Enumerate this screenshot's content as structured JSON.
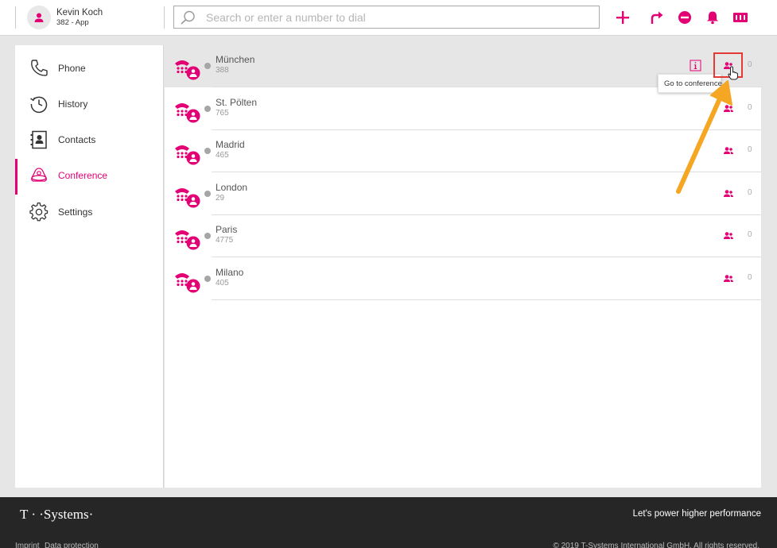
{
  "user": {
    "name": "Kevin Koch",
    "line": "382 - App"
  },
  "search": {
    "placeholder": "Search or enter a number to dial"
  },
  "header_actions": [
    "add-icon",
    "forward-icon",
    "dnd-icon",
    "bell-icon",
    "panel-icon"
  ],
  "nav": [
    {
      "id": "phone",
      "label": "Phone",
      "icon": "phone-icon"
    },
    {
      "id": "history",
      "label": "History",
      "icon": "clock-icon"
    },
    {
      "id": "contacts",
      "label": "Contacts",
      "icon": "contacts-icon"
    },
    {
      "id": "conference",
      "label": "Conference",
      "icon": "conference-icon",
      "active": true
    },
    {
      "id": "settings",
      "label": "Settings",
      "icon": "gear-icon"
    }
  ],
  "conferences": [
    {
      "name": "München",
      "number": "388",
      "count": "0",
      "hovered": true
    },
    {
      "name": "St. Pölten",
      "number": "765",
      "count": "0"
    },
    {
      "name": "Madrid",
      "number": "465",
      "count": "0"
    },
    {
      "name": "London",
      "number": "29",
      "count": "0"
    },
    {
      "name": "Paris",
      "number": "4775",
      "count": "0"
    },
    {
      "name": "Milano",
      "number": "405",
      "count": "0"
    }
  ],
  "tooltip": {
    "text": "Go to conference"
  },
  "footer": {
    "brand": "T · ·Systems·",
    "tagline": "Let's power higher performance",
    "links": [
      "Imprint",
      "Data protection"
    ],
    "copyright": "© 2019 T-Systems International GmbH. All rights reserved."
  },
  "colors": {
    "accent": "#e20074",
    "status_idle": "#a6a6a6",
    "highlight": "#e53935",
    "arrow": "#f5a623",
    "footer_bg": "#262626"
  }
}
